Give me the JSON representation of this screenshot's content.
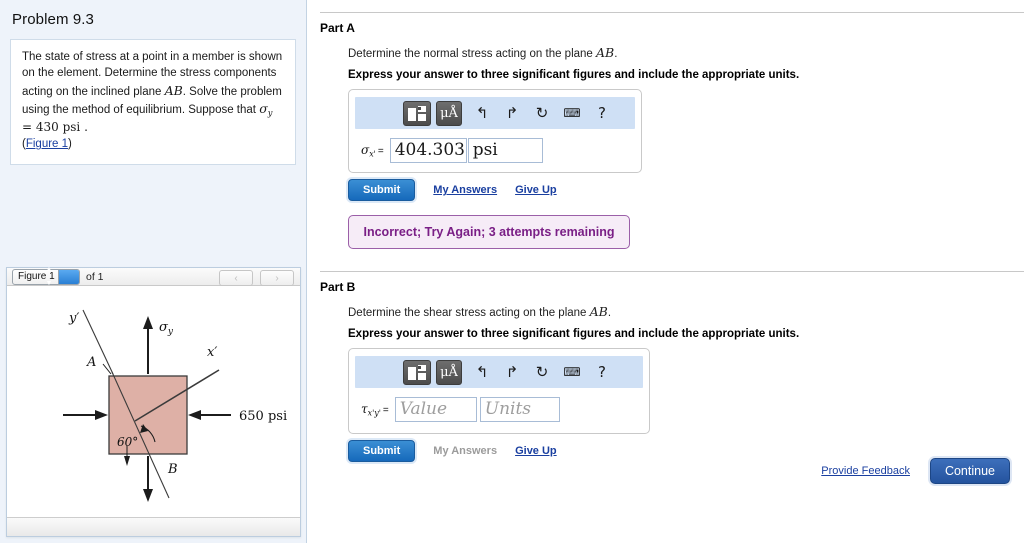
{
  "problem": {
    "title": "Problem 9.3",
    "statement_1": "The state of stress at a point in a member is shown on the element. Determine the stress components acting on the inclined plane ",
    "statement_plane": "AB",
    "statement_2": ". Solve the problem using the method of equilibrium. Suppose that ",
    "sigma_symbol": "σ",
    "sigma_sub": "y",
    "statement_3": " = 430 psi .",
    "figure_link": "(Figure 1)",
    "figure_link_text": "Figure 1"
  },
  "figure_panel": {
    "select_value": "Figure 1",
    "of_label": "of 1",
    "prev_icon": "‹",
    "next_icon": "›",
    "spinner_up": "▲",
    "spinner_down": "▼"
  },
  "figure": {
    "label_y_prime": "y'",
    "label_x_prime": "x'",
    "label_sigma_y": "σ",
    "label_sigma_y_sub": "y",
    "label_A": "A",
    "label_B": "B",
    "label_angle": "60°",
    "label_pressure": "650 psi",
    "element_fill": "#deb0a6",
    "element_stroke": "#3b3b3b"
  },
  "toolbar": {
    "sizes_icon": "template-sizes-icon",
    "units_label": "μÅ",
    "undo_icon": "↰",
    "redo_icon": "↱",
    "reset_icon": "↻",
    "keyboard_icon": "⌨",
    "help_icon": "?"
  },
  "part_a": {
    "heading": "Part A",
    "prompt_1": "Determine the normal stress acting on the plane ",
    "prompt_plane": "AB",
    "prompt_2": ".",
    "instruction": "Express your answer to three significant figures and include the appropriate units.",
    "var_symbol": "σ",
    "var_sub": "x'",
    "equals": "=",
    "value": "404.303",
    "units": "psi",
    "submit_label": "Submit",
    "my_answers_label": "My Answers",
    "give_up_label": "Give Up",
    "feedback": "Incorrect; Try Again; 3 attempts remaining"
  },
  "part_b": {
    "heading": "Part B",
    "prompt_1": "Determine the shear stress acting on the plane ",
    "prompt_plane": "AB",
    "prompt_2": ".",
    "instruction": "Express your answer to three significant figures and include the appropriate units.",
    "var_symbol": "τ",
    "var_sub": "x'y'",
    "equals": "=",
    "value_placeholder": "Value",
    "units_placeholder": "Units",
    "submit_label": "Submit",
    "my_answers_label": "My Answers",
    "give_up_label": "Give Up"
  },
  "footer": {
    "provide_feedback": "Provide Feedback",
    "continue_label": "Continue"
  },
  "colors": {
    "accent_blue": "#1669bb",
    "link_blue": "#1a3fa0",
    "panel_bg": "#eef3fa",
    "toolbar_bg": "#cfe0f5",
    "error_text": "#7a1f86",
    "error_bg": "#f6ecf7"
  }
}
